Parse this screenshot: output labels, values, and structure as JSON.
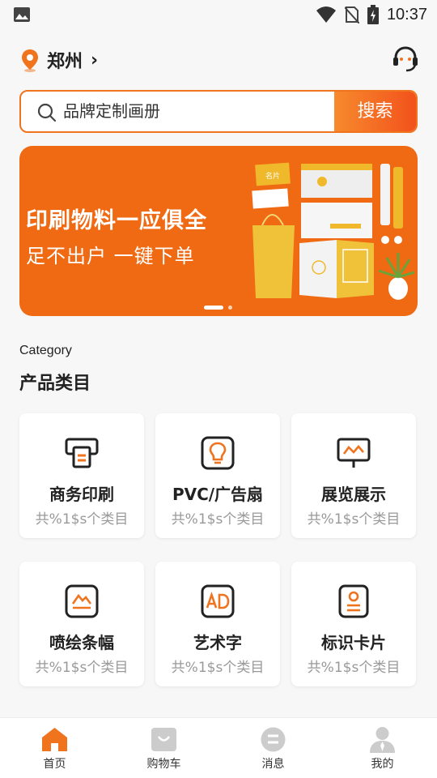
{
  "status_bar": {
    "time": "10:37"
  },
  "header": {
    "city": "郑州",
    "chevron": "›"
  },
  "search": {
    "placeholder": "品牌定制画册",
    "button_label": "搜索"
  },
  "banner": {
    "title": "印刷物料一应俱全",
    "subtitle": "足不出户  一键下单",
    "art_label": "名片",
    "page_count": 2,
    "active_page": 1
  },
  "section": {
    "label_en": "Category",
    "label_cn": "产品类目"
  },
  "categories": [
    {
      "name": "商务印刷",
      "count": "共%1$s个类目",
      "icon": "printer-icon"
    },
    {
      "name": "PVC/广告扇",
      "count": "共%1$s个类目",
      "icon": "lightbulb-icon"
    },
    {
      "name": "展览展示",
      "count": "共%1$s个类目",
      "icon": "display-board-icon"
    },
    {
      "name": "喷绘条幅",
      "count": "共%1$s个类目",
      "icon": "mountain-banner-icon"
    },
    {
      "name": "艺术字",
      "count": "共%1$s个类目",
      "icon": "ad-icon"
    },
    {
      "name": "标识卡片",
      "count": "共%1$s个类目",
      "icon": "id-card-icon"
    }
  ],
  "bottom_nav": [
    {
      "label": "首页",
      "icon": "home-icon",
      "active": true
    },
    {
      "label": "购物车",
      "icon": "shopping-bag-icon",
      "active": false
    },
    {
      "label": "消息",
      "icon": "message-icon",
      "active": false
    },
    {
      "label": "我的",
      "icon": "profile-icon",
      "active": false
    }
  ],
  "colors": {
    "accent": "#f0731e",
    "banner_bg": "#ef6a12",
    "nav_inactive": "#cccccc"
  }
}
